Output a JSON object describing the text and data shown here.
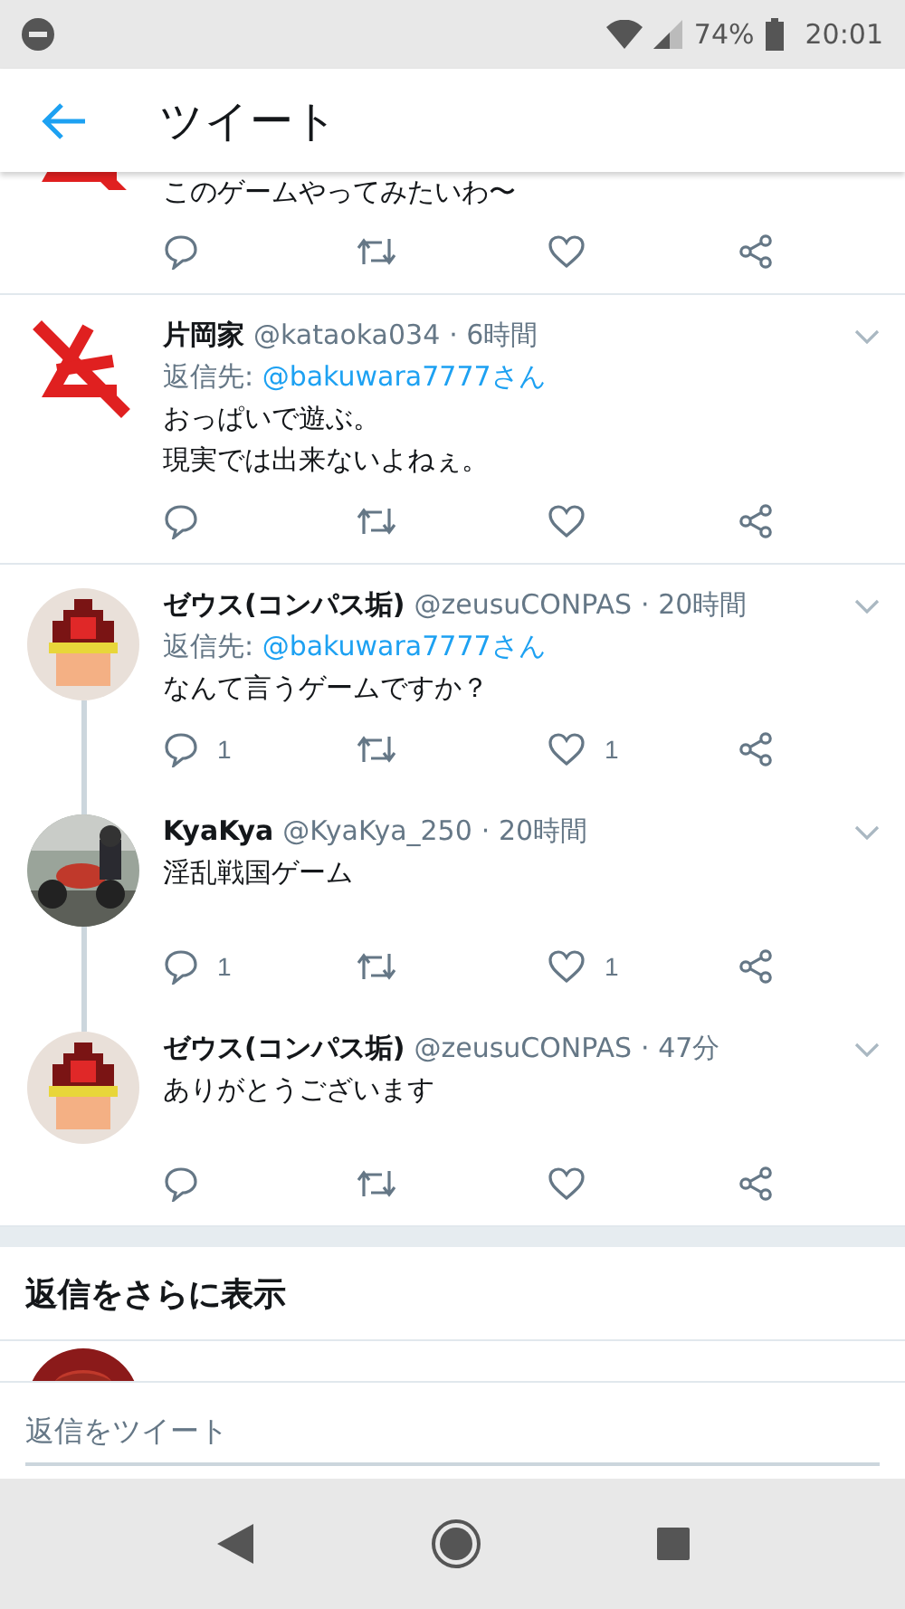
{
  "status_bar": {
    "battery": "74%",
    "time": "20:01"
  },
  "header": {
    "title": "ツイート"
  },
  "tweets": [
    {
      "kind": "cut-top",
      "avatar": {
        "kind": "red-mark"
      },
      "lines": [
        "このゲームやってみたいわ〜"
      ],
      "connected_below": false
    },
    {
      "kind": "full",
      "avatar": {
        "kind": "red-mark"
      },
      "name": "片岡家",
      "handle": "@kataoka034",
      "time": "· 6時間",
      "reply_label": "返信先:",
      "reply_to": "@bakuwara7777さん",
      "lines": [
        "おっぱいで遊ぶ。",
        "現実では出来ないよねぇ。"
      ],
      "connected_below": false
    },
    {
      "kind": "full",
      "avatar": {
        "kind": "pixel"
      },
      "name": "ゼウス(コンパス垢)",
      "handle": "@zeusuCONPAS",
      "time": "· 20時間",
      "reply_label": "返信先:",
      "reply_to": "@bakuwara7777さん",
      "lines": [
        "なんて言うゲームですか？"
      ],
      "reply_count": "1",
      "like_count": "1",
      "connected_below": true
    },
    {
      "kind": "full",
      "avatar": {
        "kind": "picture"
      },
      "name": "KyaKya",
      "handle": "@KyaKya_250",
      "time": "· 20時間",
      "lines": [
        "淫乱戦国ゲーム"
      ],
      "reply_count": "1",
      "like_count": "1",
      "connected_below": true
    },
    {
      "kind": "full",
      "avatar": {
        "kind": "pixel"
      },
      "name": "ゼウス(コンパス垢)",
      "handle": "@zeusuCONPAS",
      "time": "· 47分",
      "lines": [
        "ありがとうございます"
      ],
      "connected_below": false
    }
  ],
  "more_replies": {
    "label": "返信をさらに表示"
  },
  "partial_reply": {
    "kind": "picture"
  },
  "composer": {
    "placeholder": "返信をツイート"
  }
}
